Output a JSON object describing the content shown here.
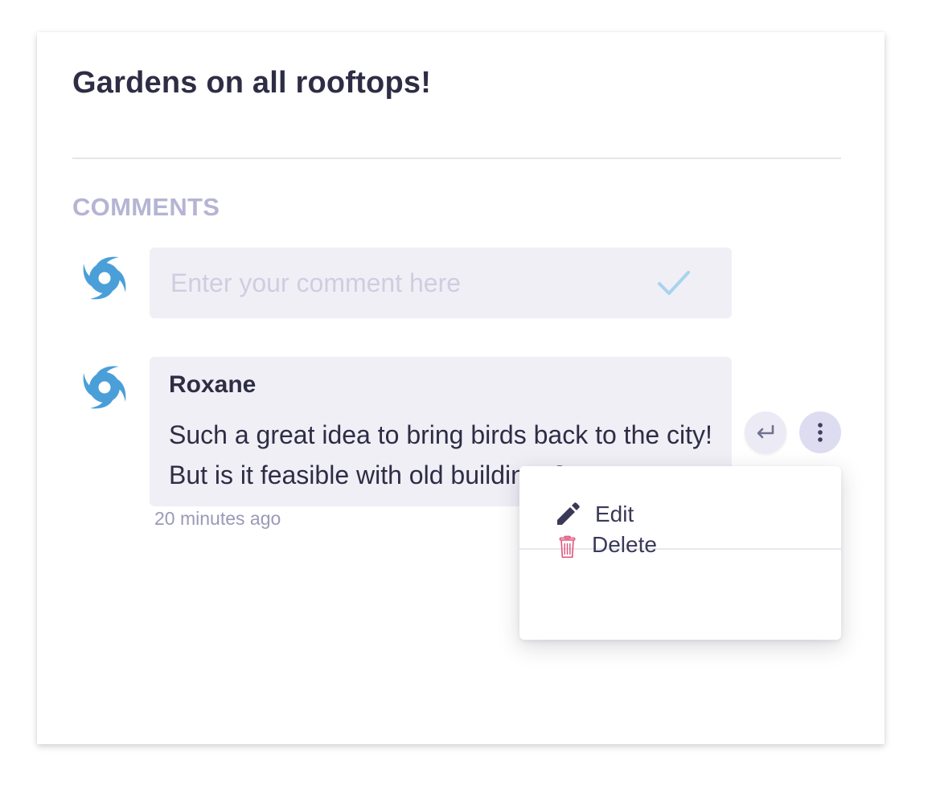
{
  "post": {
    "title": "Gardens on all rooftops!"
  },
  "comments_section": {
    "label": "COMMENTS",
    "input": {
      "placeholder": "Enter your comment here",
      "value": ""
    },
    "items": [
      {
        "author": "Roxane",
        "body": "Such a great idea to bring birds back to the city! But is it feasible with old buildings?",
        "time": "20 minutes ago"
      }
    ]
  },
  "context_menu": {
    "edit_label": "Edit",
    "delete_label": "Delete"
  },
  "icons": {
    "avatar": "hurricane-avatar-icon",
    "submit": "check-icon",
    "reply": "reply-arrow-icon",
    "more": "more-vertical-icon",
    "edit": "pencil-icon",
    "delete": "trash-icon"
  },
  "colors": {
    "title": "#2e2d45",
    "section_label": "#b5b4d3",
    "bubble_bg": "#f0eff6",
    "avatar": "#4a9fd8",
    "check": "#a9d3ef",
    "delete_icon": "#e0587e"
  }
}
